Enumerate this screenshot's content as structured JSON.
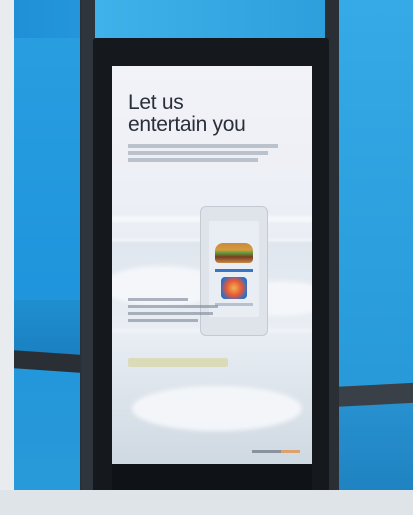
{
  "screen": {
    "headline_line1": "Let us",
    "headline_line2": "entertain you"
  },
  "colors": {
    "wall_blue": "#2a9fe0",
    "kiosk_frame": "#2b3138",
    "screen_background": "#eef1f6",
    "headline_text": "#2a2f39"
  }
}
